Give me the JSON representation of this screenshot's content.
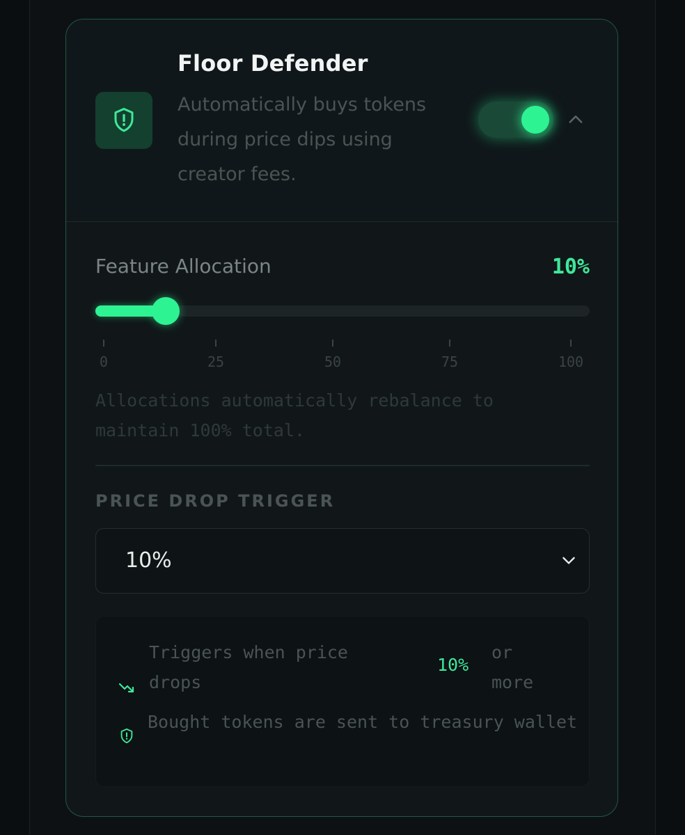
{
  "feature": {
    "title": "Floor Defender",
    "description": "Automatically buys tokens during price dips using creator fees.",
    "icon": "shield-alert-icon",
    "enabled": true
  },
  "allocation": {
    "label": "Feature Allocation",
    "value_text": "10%",
    "value": 10,
    "min": 0,
    "max": 100,
    "ticks": [
      "0",
      "25",
      "50",
      "75",
      "100"
    ],
    "note": "Allocations automatically rebalance to maintain 100% total."
  },
  "trigger": {
    "label": "PRICE DROP TRIGGER",
    "selected": "10%"
  },
  "info": {
    "line1_prefix": "Triggers when price drops",
    "line1_value": "10%",
    "line1_suffix": "or more",
    "line1_icon": "trending-down-icon",
    "line2": "Bought tokens are sent to treasury wallet",
    "line2_icon": "shield-alert-icon"
  },
  "colors": {
    "accent": "#2ef393",
    "card_border": "#1f5a43",
    "background": "#0b0e11"
  }
}
